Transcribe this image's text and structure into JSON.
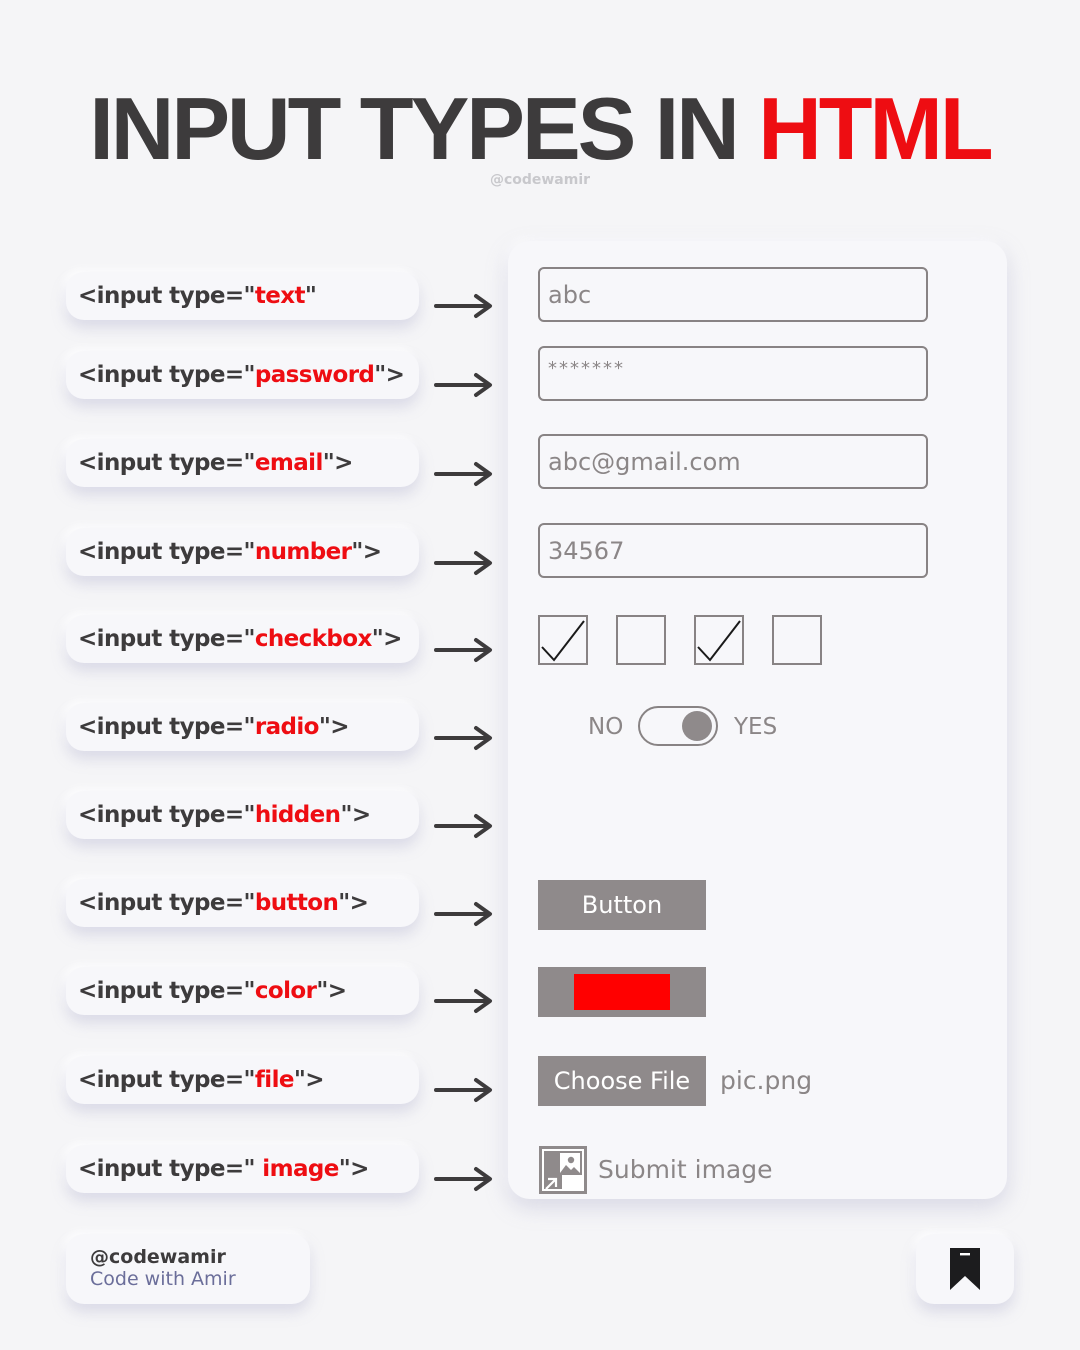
{
  "header": {
    "title_main": "INPUT TYPES IN",
    "title_accent": "HTML",
    "handle": "@codewamir"
  },
  "colors": {
    "accent": "#ee0d12",
    "dark_text": "#3d3b3c",
    "control_gray": "#8f8a8b",
    "color_value": "#ff0000"
  },
  "input_types": [
    {
      "prefix": "<input type=\"",
      "keyword": "text",
      "suffix": "\""
    },
    {
      "prefix": "<input type=\"",
      "keyword": "password",
      "suffix": "\">"
    },
    {
      "prefix": "<input type=\"",
      "keyword": "email",
      "suffix": "\">"
    },
    {
      "prefix": "<input type=\"",
      "keyword": "number",
      "suffix": "\">"
    },
    {
      "prefix": "<input type=\"",
      "keyword": "checkbox",
      "suffix": "\">"
    },
    {
      "prefix": "<input type=\"",
      "keyword": "radio",
      "suffix": "\">"
    },
    {
      "prefix": "<input type=\"",
      "keyword": "hidden",
      "suffix": "\">"
    },
    {
      "prefix": "<input type=\"",
      "keyword": "button",
      "suffix": "\">"
    },
    {
      "prefix": "<input type=\"",
      "keyword": "color",
      "suffix": "\">"
    },
    {
      "prefix": "<input type=\"",
      "keyword": "file",
      "suffix": "\">"
    },
    {
      "prefix": "<input type=\" ",
      "keyword": "image",
      "suffix": "\">"
    }
  ],
  "examples": {
    "text_value": "abc",
    "password_value": "*******",
    "email_value": "abc@gmail.com",
    "number_value": "34567",
    "checkboxes": [
      true,
      false,
      true,
      false
    ],
    "toggle": {
      "off_label": "NO",
      "on_label": "YES",
      "state": "on"
    },
    "button_label": "Button",
    "file_button_label": "Choose File",
    "file_name": "pic.png",
    "image_label": "Submit image",
    "image_icon": "image-icon"
  },
  "footer": {
    "handle": "@codewamir",
    "name": "Code with Amir",
    "bookmark_icon": "bookmark-icon"
  }
}
